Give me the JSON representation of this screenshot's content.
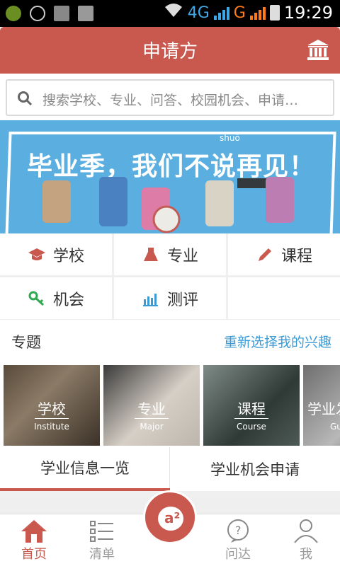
{
  "status_bar": {
    "network1": "4G",
    "network2": "G",
    "time": "19:29"
  },
  "header": {
    "title": "申请方",
    "right_icon": "bank-icon"
  },
  "search": {
    "placeholder": "搜索学校、专业、问答、校园机会、申请…"
  },
  "banner": {
    "slogan": "毕业季，我们不说再见！",
    "pinyin": "shuō"
  },
  "categories": [
    {
      "label": "学校",
      "icon": "graduation-cap-icon",
      "color": "#c9584f"
    },
    {
      "label": "专业",
      "icon": "flask-icon",
      "color": "#c9584f"
    },
    {
      "label": "课程",
      "icon": "pencil-icon",
      "color": "#c9584f"
    },
    {
      "label": "机会",
      "icon": "key-icon",
      "color": "#2fa84f"
    },
    {
      "label": "测评",
      "icon": "bar-chart-icon",
      "color": "#3a9bd6"
    }
  ],
  "topics": {
    "title": "专题",
    "reselect": "重新选择我的兴趣",
    "cards": [
      {
        "zh": "学校",
        "en": "Institute"
      },
      {
        "zh": "专业",
        "en": "Major"
      },
      {
        "zh": "课程",
        "en": "Course"
      },
      {
        "zh": "学业发",
        "en": "Gu"
      }
    ]
  },
  "tabs": [
    {
      "label": "学业信息一览"
    },
    {
      "label": "学业机会申请"
    }
  ],
  "bottom_nav": [
    {
      "label": "首页"
    },
    {
      "label": "清单"
    },
    {
      "label": "问达"
    },
    {
      "label": "我"
    }
  ],
  "colors": {
    "primary": "#c9584f",
    "link": "#3a9bd6"
  }
}
